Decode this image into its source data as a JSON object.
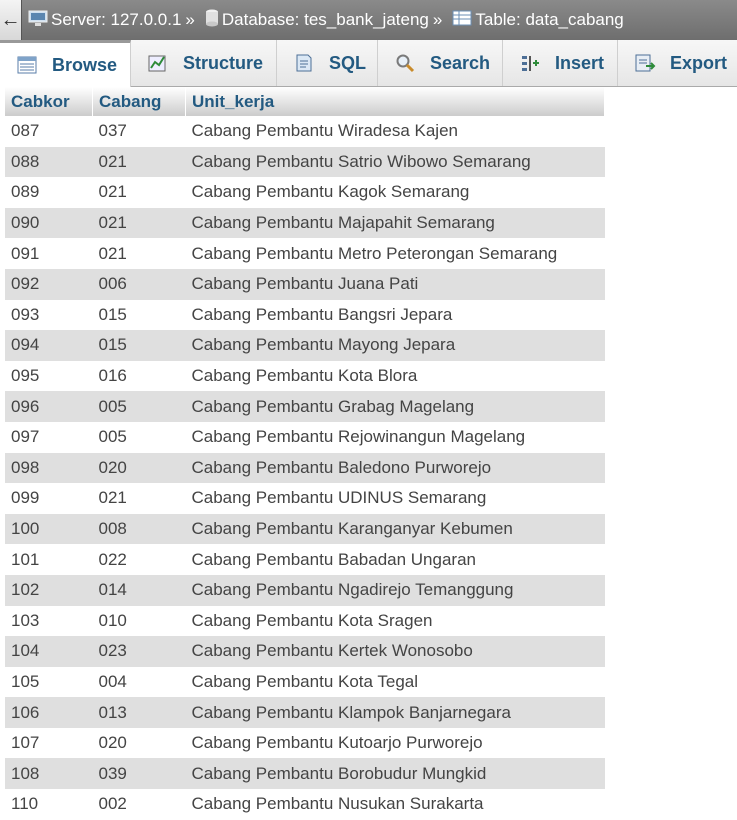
{
  "breadcrumb": {
    "back": "←",
    "server": "Server: 127.0.0.1",
    "database": "Database: tes_bank_jateng",
    "table": "Table: data_cabang",
    "sep": "»"
  },
  "tabs": [
    {
      "label": "Browse",
      "icon": "browse-icon",
      "active": true
    },
    {
      "label": "Structure",
      "icon": "structure-icon"
    },
    {
      "label": "SQL",
      "icon": "sql-icon"
    },
    {
      "label": "Search",
      "icon": "search-icon"
    },
    {
      "label": "Insert",
      "icon": "insert-icon"
    },
    {
      "label": "Export",
      "icon": "export-icon"
    }
  ],
  "table": {
    "columns": [
      "Cabkor",
      "Cabang",
      "Unit_kerja"
    ],
    "rows": [
      [
        "087",
        "037",
        "Cabang Pembantu Wiradesa Kajen"
      ],
      [
        "088",
        "021",
        "Cabang Pembantu Satrio Wibowo Semarang"
      ],
      [
        "089",
        "021",
        "Cabang Pembantu Kagok Semarang"
      ],
      [
        "090",
        "021",
        "Cabang Pembantu Majapahit Semarang"
      ],
      [
        "091",
        "021",
        "Cabang Pembantu Metro Peterongan Semarang"
      ],
      [
        "092",
        "006",
        "Cabang Pembantu Juana Pati"
      ],
      [
        "093",
        "015",
        "Cabang Pembantu Bangsri Jepara"
      ],
      [
        "094",
        "015",
        "Cabang Pembantu Mayong Jepara"
      ],
      [
        "095",
        "016",
        "Cabang Pembantu Kota Blora"
      ],
      [
        "096",
        "005",
        "Cabang Pembantu Grabag Magelang"
      ],
      [
        "097",
        "005",
        "Cabang Pembantu Rejowinangun Magelang"
      ],
      [
        "098",
        "020",
        "Cabang Pembantu Baledono Purworejo"
      ],
      [
        "099",
        "021",
        "Cabang Pembantu UDINUS Semarang"
      ],
      [
        "100",
        "008",
        "Cabang Pembantu Karanganyar Kebumen"
      ],
      [
        "101",
        "022",
        "Cabang Pembantu Babadan Ungaran"
      ],
      [
        "102",
        "014",
        "Cabang Pembantu Ngadirejo Temanggung"
      ],
      [
        "103",
        "010",
        "Cabang Pembantu Kota Sragen"
      ],
      [
        "104",
        "023",
        "Cabang Pembantu Kertek Wonosobo"
      ],
      [
        "105",
        "004",
        "Cabang Pembantu Kota Tegal"
      ],
      [
        "106",
        "013",
        "Cabang Pembantu Klampok Banjarnegara"
      ],
      [
        "107",
        "020",
        "Cabang Pembantu Kutoarjo Purworejo"
      ],
      [
        "108",
        "039",
        "Cabang Pembantu Borobudur Mungkid"
      ],
      [
        "110",
        "002",
        "Cabang Pembantu Nusukan Surakarta"
      ]
    ]
  }
}
